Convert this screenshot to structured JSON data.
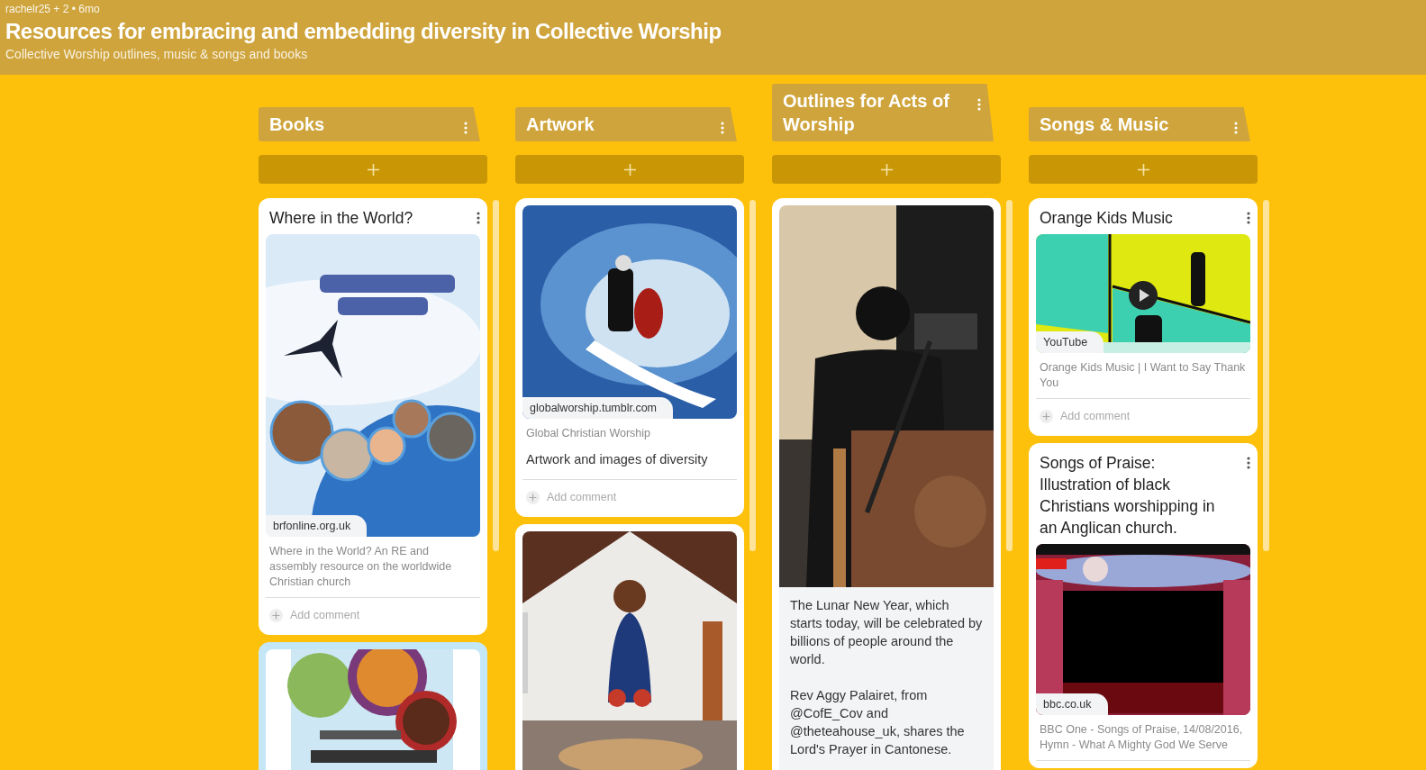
{
  "header": {
    "byline": "rachelr25 + 2 • 6mo",
    "title": "Resources for embracing and embedding diversity in Collective Worship",
    "subtitle": "Collective Worship outlines, music & songs and books"
  },
  "columns": [
    {
      "title": "Books",
      "posts": [
        {
          "kind": "link",
          "title": "Where in the World?",
          "picture": {
            "kind": "picture"
          },
          "source": "brfonline.org.uk",
          "link_title": "Where in the World? An RE and assembly resource on the worldwide Christian church",
          "add_comment": "Add comment"
        },
        {
          "kind": "link",
          "color": "#c4e7f8",
          "picture": {
            "kind": "picture"
          }
        }
      ]
    },
    {
      "title": "Artwork",
      "posts": [
        {
          "kind": "link",
          "picture": {
            "kind": "picture"
          },
          "source": "globalworship.tumblr.com",
          "link_title": "Global Christian Worship",
          "body": "Artwork and images of diversity",
          "add_comment": "Add comment"
        },
        {
          "kind": "link",
          "picture": {
            "kind": "picture"
          }
        }
      ]
    },
    {
      "title": "Outlines for Acts of Worship",
      "posts": [
        {
          "kind": "upload",
          "picture": {
            "kind": "picture"
          },
          "paragraphs": [
            "The Lunar New Year, which starts today, will be celebrated by billions of people around the world.",
            "Rev Aggy Palairet, from @CofE_Cov and @theteahouse_uk, shares the Lord's Prayer in Cantonese."
          ]
        }
      ]
    },
    {
      "title": "Songs & Music",
      "posts": [
        {
          "kind": "link",
          "title": "Orange Kids Music",
          "picture": {
            "kind": "picture",
            "playable": true
          },
          "source": "YouTube",
          "link_title": "Orange Kids Music | I Want to Say Thank You",
          "add_comment": "Add comment"
        },
        {
          "kind": "link",
          "title": "Songs of Praise: Illustration of black Christians worshipping in an Anglican church.",
          "picture": {
            "kind": "picture"
          },
          "source": "bbc.co.uk",
          "link_title": "BBC One - Songs of Praise, 14/08/2016, Hymn - What A Mighty God We Serve"
        }
      ]
    }
  ]
}
